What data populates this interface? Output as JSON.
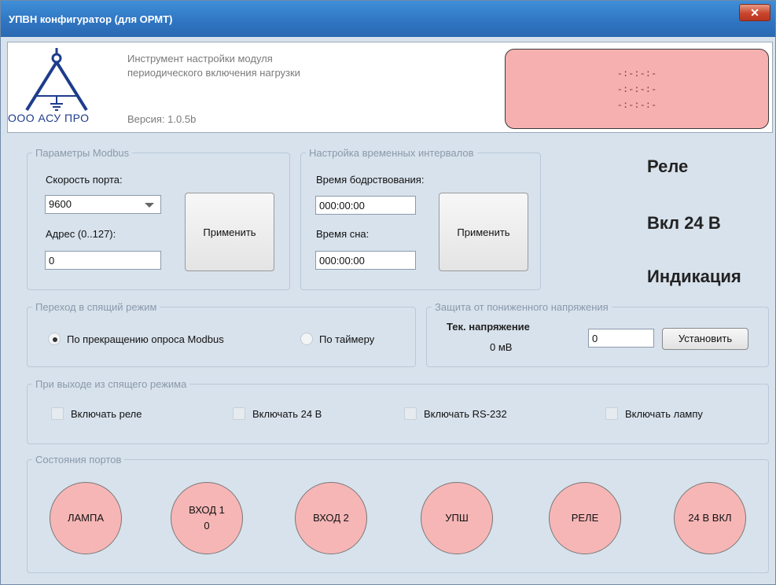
{
  "window": {
    "title": "УПВН конфигуратор (для ОРМТ)",
    "close_glyph": "✕"
  },
  "header": {
    "logo_text": "ООО АСУ ПРО",
    "description_line1": "Инструмент настройки модуля",
    "description_line2": "периодического включения нагрузки",
    "version_label": "Версия: 1.0.5b",
    "display_lines": [
      "-:-:-:-",
      "-:-:-:-",
      "-:-:-:-"
    ],
    "display_color": "#f7b0b0"
  },
  "modbus": {
    "legend": "Параметры Modbus",
    "port_speed_label": "Скорость порта:",
    "port_speed_value": "9600",
    "address_label": "Адрес (0..127):",
    "address_value": "0",
    "apply_label": "Применить"
  },
  "intervals": {
    "legend": "Настройка временных интервалов",
    "awake_label": "Время бодрствования:",
    "awake_value": "000:00:00",
    "sleep_label": "Время сна:",
    "sleep_value": "000:00:00",
    "apply_label": "Применить"
  },
  "status": {
    "relay": "Реле",
    "power24": "Вкл 24 В",
    "indication": "Индикация"
  },
  "sleep_mode": {
    "legend": "Переход в спящий режим",
    "option_modbus": "По прекращению опроса Modbus",
    "option_timer": "По таймеру",
    "selected": "modbus"
  },
  "undervoltage": {
    "legend": "Защита от пониженного напряжения",
    "current_voltage_label": "Тек. напряжение",
    "current_voltage_value": "0 мВ",
    "threshold_value": "0",
    "set_label": "Установить"
  },
  "wake": {
    "legend": "При выходе из спящего режима",
    "relay": "Включать реле",
    "power24": "Включать 24 В",
    "rs232": "Включать RS-232",
    "lamp": "Включать лампу"
  },
  "ports": {
    "legend": "Состояния портов",
    "items": [
      {
        "label": "ЛАМПА",
        "value": ""
      },
      {
        "label": "ВХОД 1",
        "value": "0"
      },
      {
        "label": "ВХОД 2",
        "value": ""
      },
      {
        "label": "УПШ",
        "value": ""
      },
      {
        "label": "РЕЛЕ",
        "value": ""
      },
      {
        "label": "24 В ВКЛ",
        "value": ""
      }
    ],
    "led_color": "#f7b6b6"
  }
}
